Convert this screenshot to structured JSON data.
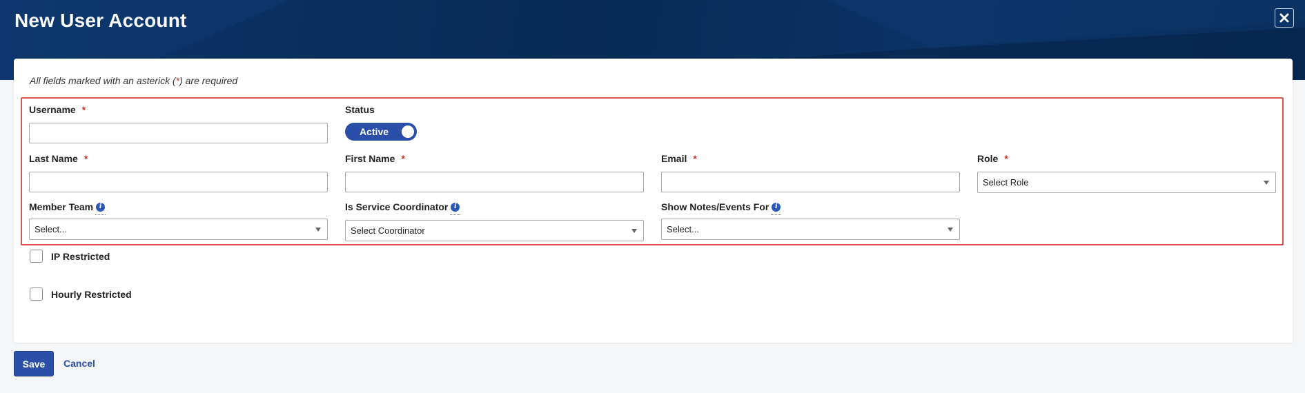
{
  "dialog": {
    "title": "New User Account",
    "close_icon": "close-icon"
  },
  "form": {
    "required_note_prefix": "All fields marked with an asterick (",
    "required_note_asterisk": "*",
    "required_note_suffix": ") are required",
    "required_marker": "*",
    "username": {
      "label": "Username",
      "value": ""
    },
    "status": {
      "label": "Status",
      "toggle_text": "Active",
      "on": true
    },
    "last_name": {
      "label": "Last Name",
      "value": ""
    },
    "first_name": {
      "label": "First Name",
      "value": ""
    },
    "email": {
      "label": "Email",
      "value": ""
    },
    "role": {
      "label": "Role",
      "selected": "Select Role"
    },
    "member_team": {
      "label": "Member Team",
      "selected": "Select..."
    },
    "service_coordinator": {
      "label": "Is Service Coordinator",
      "selected": "Select Coordinator"
    },
    "show_notes": {
      "label": "Show Notes/Events For",
      "selected": "Select..."
    },
    "ip_restricted": {
      "label": "IP Restricted",
      "checked": false
    },
    "hourly_restricted": {
      "label": "Hourly Restricted",
      "checked": false
    },
    "info_glyph": "i"
  },
  "footer": {
    "save_label": "Save",
    "cancel_label": "Cancel"
  },
  "colors": {
    "header_bg": "#0a3264",
    "primary": "#2b4ea8",
    "required": "#c9302c",
    "highlight_border": "#d9534f"
  }
}
